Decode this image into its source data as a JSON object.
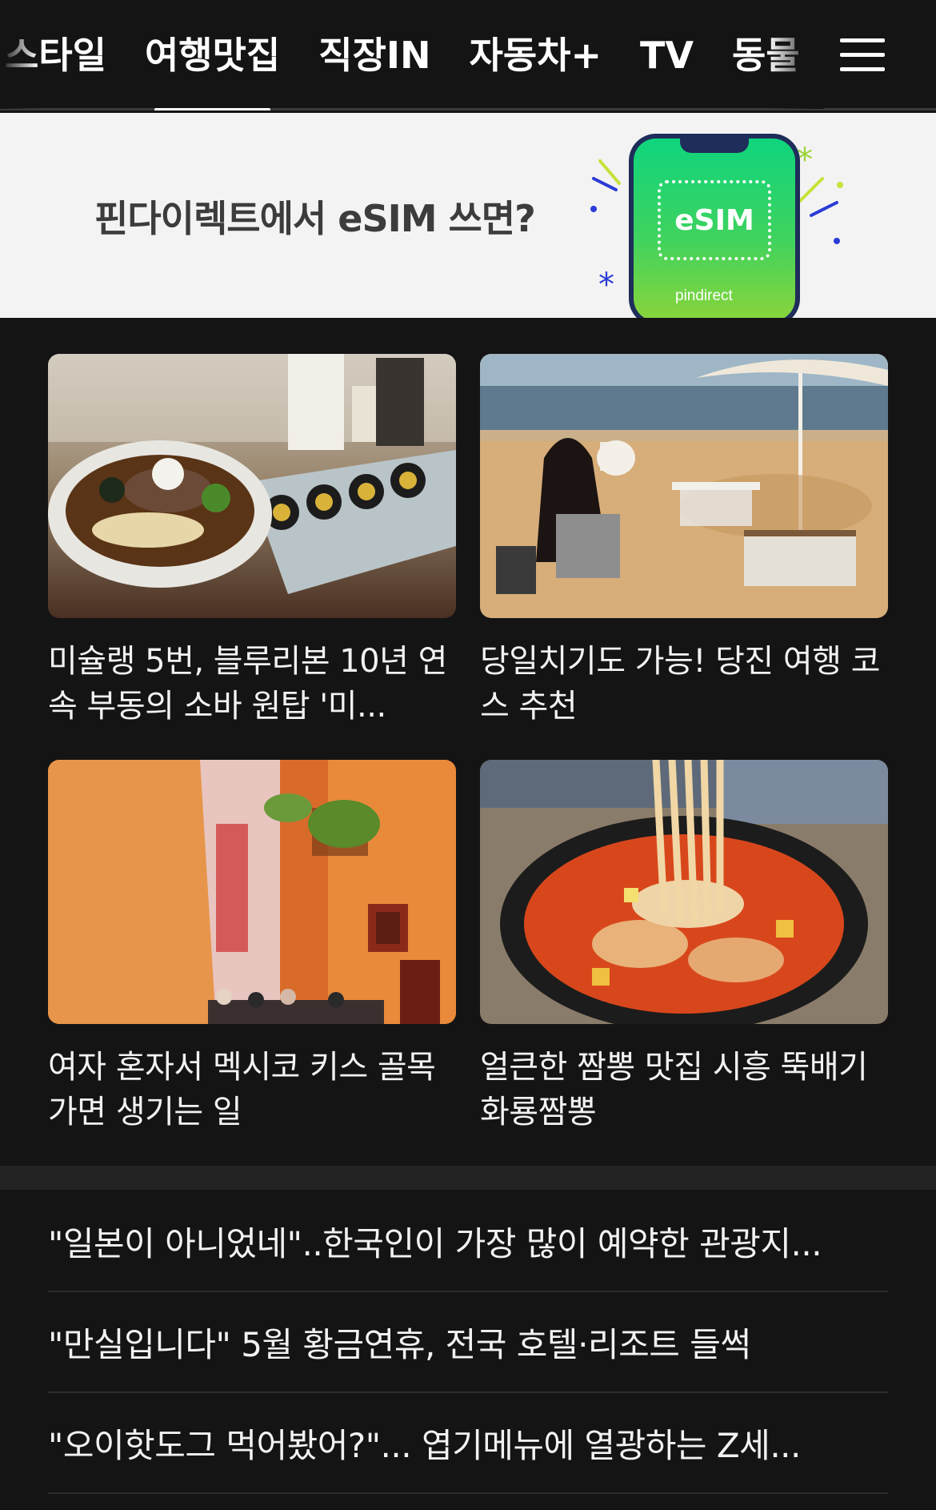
{
  "nav": {
    "tabs": [
      "스타일",
      "여행맛집",
      "직장IN",
      "자동차+",
      "TV",
      "동물"
    ],
    "active_tab": "여행맛집",
    "menu_icon": "hamburger-menu-icon"
  },
  "banner": {
    "text": "핀다이렉트에서 eSIM 쓰면?",
    "phone_label": "eSIM",
    "brand": "pindirect",
    "colors": {
      "background": "#f3f3f3",
      "phone_green": "#1fd46e",
      "accent_blue": "#2a3bd6"
    }
  },
  "cards": [
    {
      "title": "미슐랭 5번, 블루리본 10년 연속 부동의 소바 원탑 '미...",
      "image": "soba-and-gimbap-photo"
    },
    {
      "title": "당일치기도 가능! 당진 여행 코스 추천",
      "image": "beach-camping-photo"
    },
    {
      "title": "여자 혼자서 멕시코 키스 골목가면 생기는 일",
      "image": "mexico-alley-photo"
    },
    {
      "title": "얼큰한 짬뽕 맛집 시흥 뚝배기화룡짬뽕",
      "image": "jjamppong-photo"
    }
  ],
  "list": [
    "\"일본이 아니었네\"..한국인이 가장 많이 예약한 관광지...",
    "\"만실입니다\" 5월 황금연휴, 전국 호텔·리조트 들썩",
    "\"오이핫도그 먹어봤어?\"... 엽기메뉴에 열광하는 Z세..."
  ]
}
